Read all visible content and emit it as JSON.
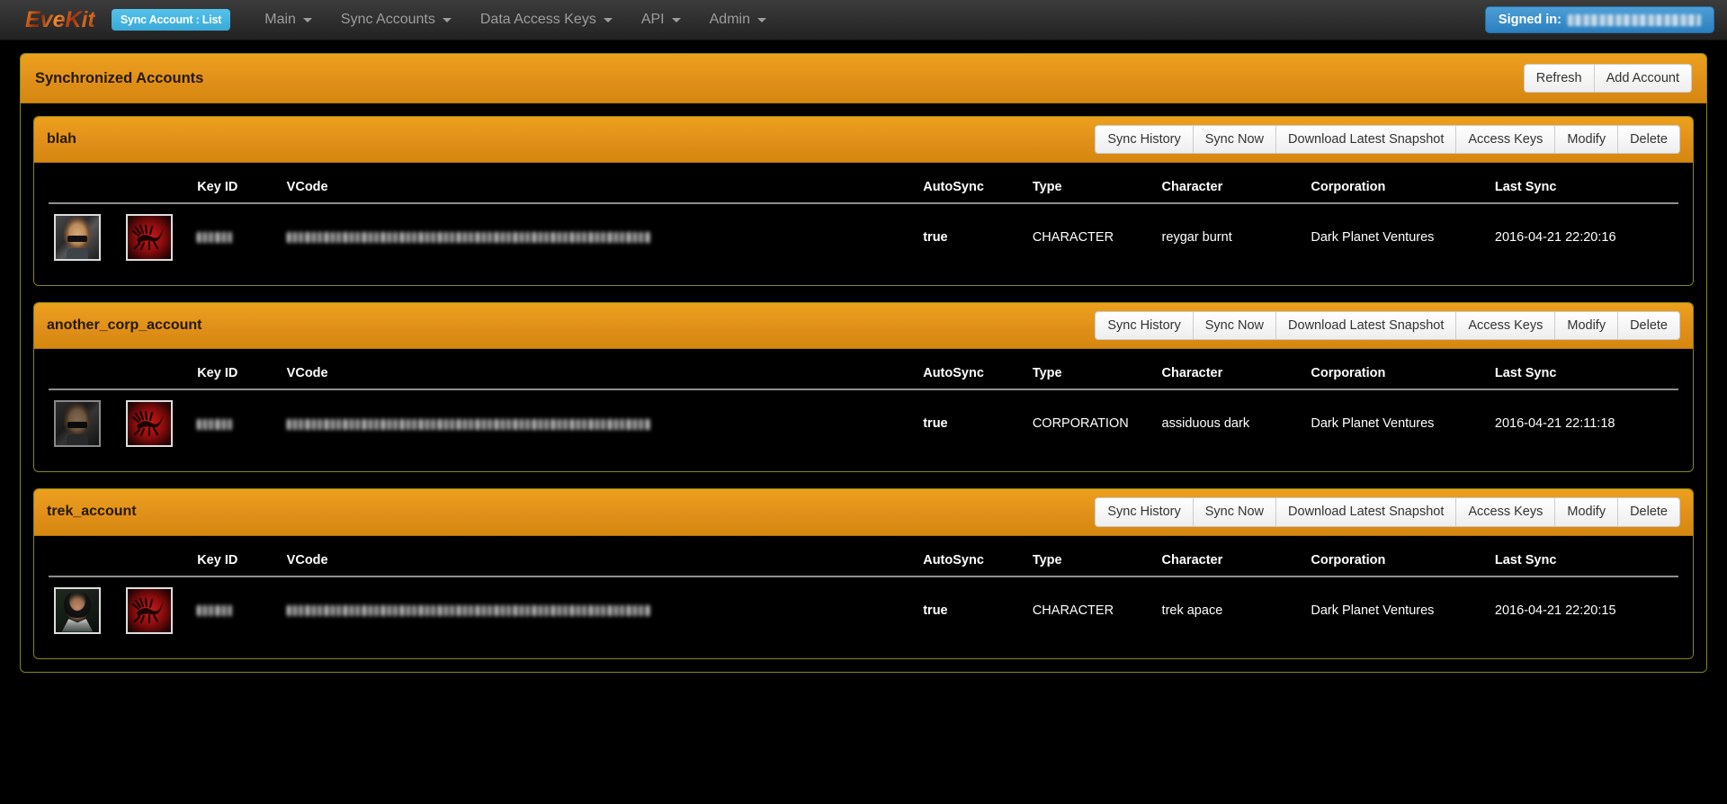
{
  "navbar": {
    "brand": "EveKit",
    "active_badge": "Sync Account : List",
    "items": [
      {
        "label": "Main",
        "caret": true
      },
      {
        "label": "Sync Accounts",
        "caret": true
      },
      {
        "label": "Data Access Keys",
        "caret": true
      },
      {
        "label": "API",
        "caret": true
      },
      {
        "label": "Admin",
        "caret": true
      }
    ],
    "signed_in_label": "Signed in:",
    "signed_in_user": ""
  },
  "page": {
    "panel_title": "Synchronized Accounts",
    "refresh_label": "Refresh",
    "add_account_label": "Add Account"
  },
  "account_actions": [
    "Sync History",
    "Sync Now",
    "Download Latest Snapshot",
    "Access Keys",
    "Modify",
    "Delete"
  ],
  "table_headers": [
    "Key ID",
    "VCode",
    "AutoSync",
    "Type",
    "Character",
    "Corporation",
    "Last Sync"
  ],
  "accounts": [
    {
      "name": "blah",
      "portrait_icon": "character-portrait-bald-male",
      "corp_icon": "corporation-logo-red-scorpion",
      "row": {
        "key_id": "",
        "vcode": "",
        "autosync": "true",
        "type": "CHARACTER",
        "character": "reygar burnt",
        "corporation": "Dark Planet Ventures",
        "last_sync": "2016-04-21 22:20:16"
      }
    },
    {
      "name": "another_corp_account",
      "portrait_icon": "character-portrait-dark-male",
      "corp_icon": "corporation-logo-red-scorpion",
      "row": {
        "key_id": "",
        "vcode": "",
        "autosync": "true",
        "type": "CORPORATION",
        "character": "assiduous dark",
        "corporation": "Dark Planet Ventures",
        "last_sync": "2016-04-21 22:11:18"
      }
    },
    {
      "name": "trek_account",
      "portrait_icon": "character-portrait-female",
      "corp_icon": "corporation-logo-red-scorpion",
      "row": {
        "key_id": "",
        "vcode": "",
        "autosync": "true",
        "type": "CHARACTER",
        "character": "trek apace",
        "corporation": "Dark Planet Ventures",
        "last_sync": "2016-04-21 22:20:15"
      }
    }
  ],
  "colors": {
    "panel_orange": "#e0901a",
    "panel_border": "#8a8a0f",
    "navbar_dark": "#2d2d2d",
    "badge_blue": "#3aa9d8",
    "signed_in_blue": "#2b7fbe",
    "background": "#000000"
  }
}
